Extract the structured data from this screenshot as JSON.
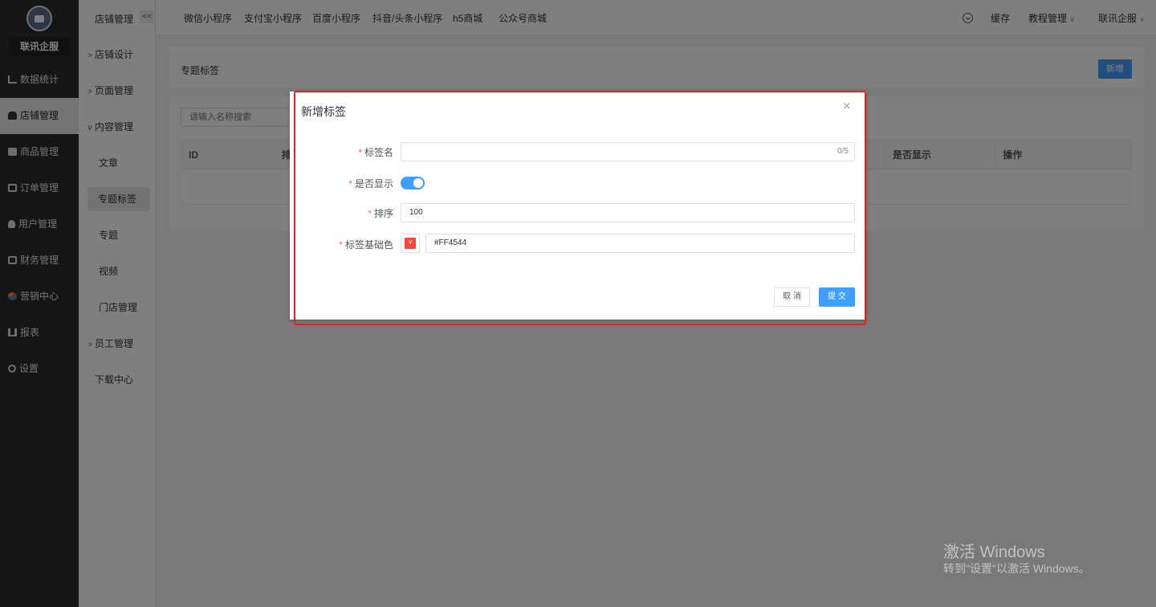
{
  "brand": {
    "name": "联讯企服",
    "logo_icon": "store-icon"
  },
  "main_nav": [
    {
      "label": "数据统计",
      "icon": "chart-icon",
      "active": false
    },
    {
      "label": "店铺管理",
      "icon": "shop-icon",
      "active": true
    },
    {
      "label": "商品管理",
      "icon": "goods-icon",
      "active": false
    },
    {
      "label": "订单管理",
      "icon": "order-icon",
      "active": false
    },
    {
      "label": "用户管理",
      "icon": "user-icon",
      "active": false
    },
    {
      "label": "财务管理",
      "icon": "finance-icon",
      "active": false
    },
    {
      "label": "营销中心",
      "icon": "marketing-icon",
      "active": false
    },
    {
      "label": "报表",
      "icon": "report-icon",
      "active": false
    },
    {
      "label": "设置",
      "icon": "gear-icon",
      "active": false
    }
  ],
  "sub_nav": {
    "header": "店铺管理",
    "collapse_label": "<<",
    "items": [
      {
        "label": "店铺设计",
        "arrow": ">"
      },
      {
        "label": "页面管理",
        "arrow": ">"
      },
      {
        "label": "内容管理",
        "arrow": "∨"
      },
      {
        "label": "文章"
      },
      {
        "label": "专题标签",
        "selected": true
      },
      {
        "label": "专题"
      },
      {
        "label": "视频"
      },
      {
        "label": "门店管理"
      },
      {
        "label": "员工管理",
        "arrow": ">"
      },
      {
        "label": "下载中心"
      }
    ]
  },
  "top_tabs": [
    "微信小程序",
    "支付宝小程序",
    "百度小程序",
    "抖音/头条小程序",
    "h5商城",
    "公众号商城"
  ],
  "top_right": {
    "cache": "缓存",
    "tutorial": "教程管理",
    "account": "联讯企服"
  },
  "page": {
    "title": "专题标签",
    "add_button": "新增",
    "search_placeholder": "请输入名称搜索",
    "columns": [
      "ID",
      "排序",
      "",
      "",
      "",
      "",
      "",
      "是否显示",
      "操作"
    ]
  },
  "dialog": {
    "title": "新增标签",
    "close": "×",
    "fields": {
      "name": {
        "label": "标签名",
        "value": "",
        "counter": "0/5"
      },
      "show": {
        "label": "是否显示",
        "enabled": true
      },
      "sort": {
        "label": "排序",
        "value": "100"
      },
      "color": {
        "label": "标签基础色",
        "value": "#FF4544",
        "swatch": "#FF4544"
      }
    },
    "cancel": "取 消",
    "submit": "提 交"
  },
  "watermark": {
    "line1": "激活 Windows",
    "line2": "转到\"设置\"以激活 Windows。"
  },
  "colors": {
    "accent": "#409eff",
    "sidebar_bg": "#2b2b2b",
    "required": "#f56c6c",
    "highlight_box": "#e0211f"
  }
}
